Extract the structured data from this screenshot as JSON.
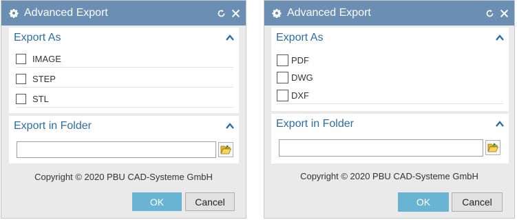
{
  "dialogs": [
    {
      "title": "Advanced Export",
      "export_as": {
        "title": "Export As",
        "options": [
          {
            "label": "IMAGE",
            "checked": false
          },
          {
            "label": "STEP",
            "checked": false
          },
          {
            "label": "STL",
            "checked": false
          }
        ]
      },
      "export_folder": {
        "title": "Export in Folder",
        "value": ""
      },
      "copyright": "Copyright © 2020 PBU CAD-Systeme GmbH",
      "ok_label": "OK",
      "cancel_label": "Cancel"
    },
    {
      "title": "Advanced Export",
      "export_as": {
        "title": "Export As",
        "options": [
          {
            "label": "PDF",
            "checked": false
          },
          {
            "label": "DWG",
            "checked": false
          },
          {
            "label": "DXF",
            "checked": false
          }
        ]
      },
      "export_folder": {
        "title": "Export in Folder",
        "value": ""
      },
      "copyright": "Copyright © 2020 PBU CAD-Systeme GmbH",
      "ok_label": "OK",
      "cancel_label": "Cancel"
    }
  ],
  "icons": {
    "title": "gear-icon",
    "reset": "reset-icon",
    "close": "close-icon",
    "collapse": "chevron-up-icon",
    "folder": "folder-open-icon"
  },
  "colors": {
    "titlebar": "#6a8fb3",
    "section_title": "#2a6ea6",
    "ok_button": "#6ab4d3",
    "dialog_bg": "#eaeaea"
  }
}
